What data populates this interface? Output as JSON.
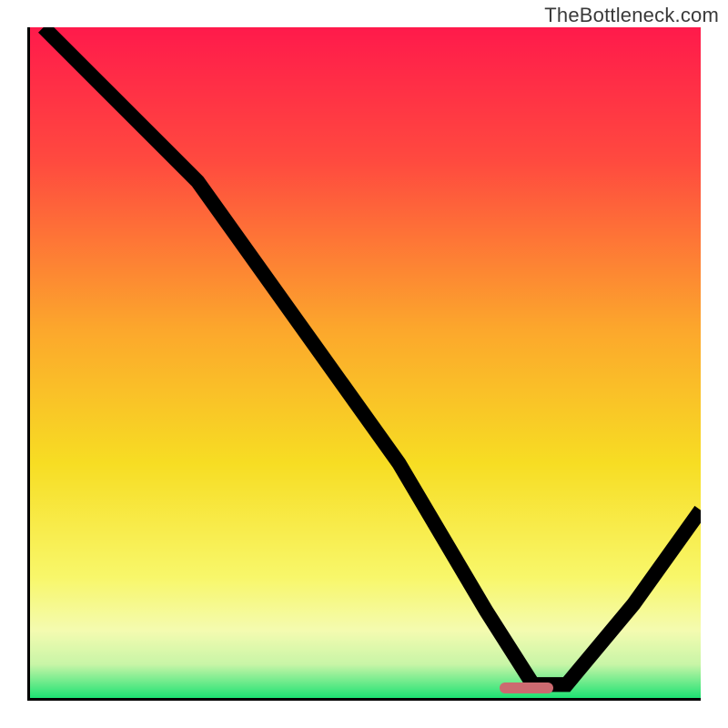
{
  "watermark": "TheBottleneck.com",
  "chart_data": {
    "type": "line",
    "title": "",
    "xlabel": "",
    "ylabel": "",
    "xlim": [
      0,
      100
    ],
    "ylim": [
      0,
      100
    ],
    "grid": false,
    "background": "rainbow-gradient",
    "annotations": [
      {
        "type": "marker-bar",
        "x_range": [
          70,
          78
        ],
        "y": 1.5,
        "color": "#cc6a70"
      }
    ],
    "series": [
      {
        "name": "bottleneck-curve",
        "x": [
          2,
          10,
          20,
          25,
          40,
          55,
          68,
          75,
          80,
          90,
          100
        ],
        "values": [
          100,
          92,
          82,
          77,
          56,
          35,
          13,
          2,
          2,
          14,
          28
        ]
      }
    ],
    "gradient_stops": [
      {
        "pos": 0,
        "color": "#ff1a4b"
      },
      {
        "pos": 20,
        "color": "#ff4a3f"
      },
      {
        "pos": 45,
        "color": "#fca72c"
      },
      {
        "pos": 65,
        "color": "#f7dd23"
      },
      {
        "pos": 82,
        "color": "#f8f76a"
      },
      {
        "pos": 90,
        "color": "#f4fbb0"
      },
      {
        "pos": 95,
        "color": "#c8f5a7"
      },
      {
        "pos": 100,
        "color": "#1de273"
      }
    ]
  }
}
